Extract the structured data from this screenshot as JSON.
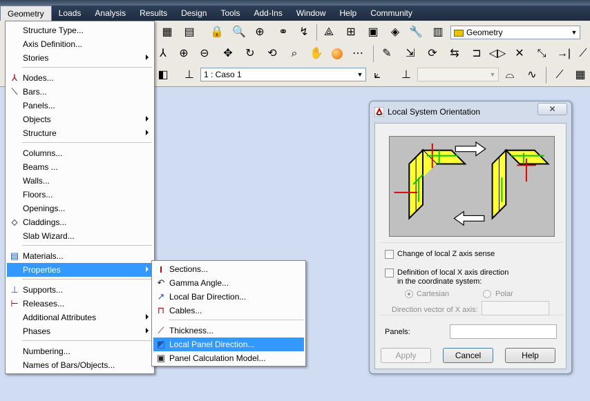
{
  "menubar": {
    "items": [
      "Geometry",
      "Loads",
      "Analysis",
      "Results",
      "Design",
      "Tools",
      "Add-Ins",
      "Window",
      "Help",
      "Community"
    ]
  },
  "toolbar": {
    "layout_combo": "Geometry",
    "case_combo": "1 : Caso 1",
    "empty_combo": ""
  },
  "geometry_menu": {
    "items": [
      {
        "label": "Structure Type...",
        "icon": "",
        "submenu": false
      },
      {
        "label": "Axis Definition...",
        "icon": "",
        "submenu": false
      },
      {
        "label": "Stories",
        "icon": "",
        "submenu": true
      },
      {
        "label": "Nodes...",
        "icon": "node-icon",
        "submenu": false
      },
      {
        "label": "Bars...",
        "icon": "bar-icon",
        "submenu": false
      },
      {
        "label": "Panels...",
        "icon": "",
        "submenu": false
      },
      {
        "label": "Objects",
        "icon": "",
        "submenu": true
      },
      {
        "label": "Structure",
        "icon": "",
        "submenu": true
      },
      {
        "label": "Columns...",
        "icon": "",
        "submenu": false
      },
      {
        "label": "Beams ...",
        "icon": "",
        "submenu": false
      },
      {
        "label": "Walls...",
        "icon": "",
        "submenu": false
      },
      {
        "label": "Floors...",
        "icon": "",
        "submenu": false
      },
      {
        "label": "Openings...",
        "icon": "",
        "submenu": false
      },
      {
        "label": "Claddings...",
        "icon": "cladding-icon",
        "submenu": false
      },
      {
        "label": "Slab Wizard...",
        "icon": "",
        "submenu": false
      },
      {
        "label": "Materials...",
        "icon": "materials-icon",
        "submenu": false
      },
      {
        "label": "Properties",
        "icon": "",
        "submenu": true
      },
      {
        "label": "Supports...",
        "icon": "supports-icon",
        "submenu": false
      },
      {
        "label": "Releases...",
        "icon": "releases-icon",
        "submenu": false
      },
      {
        "label": "Additional Attributes",
        "icon": "",
        "submenu": true
      },
      {
        "label": "Phases",
        "icon": "",
        "submenu": true
      },
      {
        "label": "Numbering...",
        "icon": "",
        "submenu": false
      },
      {
        "label": "Names of Bars/Objects...",
        "icon": "",
        "submenu": false
      }
    ]
  },
  "properties_submenu": {
    "items": [
      {
        "label": "Sections...",
        "icon": "section-icon"
      },
      {
        "label": "Gamma Angle...",
        "icon": "gamma-angle-icon"
      },
      {
        "label": "Local Bar Direction...",
        "icon": "local-bar-direction-icon"
      },
      {
        "label": "Cables...",
        "icon": "cables-icon"
      },
      {
        "label": "Thickness...",
        "icon": "thickness-icon"
      },
      {
        "label": "Local Panel Direction...",
        "icon": "local-panel-direction-icon"
      },
      {
        "label": "Panel Calculation Model...",
        "icon": "panel-calculation-model-icon"
      }
    ]
  },
  "dialog": {
    "title": "Local System Orientation",
    "close": "✕",
    "change_z": "Change of local Z axis sense",
    "def_x_line1": "Definition of local X axis direction",
    "def_x_line2": "in the coordinate system:",
    "cartesian": "Cartesian",
    "polar": "Polar",
    "direction_vector": "Direction vector of X axis:",
    "panels_label": "Panels:",
    "panels_value": "",
    "apply": "Apply",
    "cancel": "Cancel",
    "help": "Help"
  },
  "colors": {
    "menu_highlight": "#3399ff",
    "menubar": "#1e2c40",
    "canvas": "#cfdcf2",
    "panel_yellow": "#ffff33"
  }
}
